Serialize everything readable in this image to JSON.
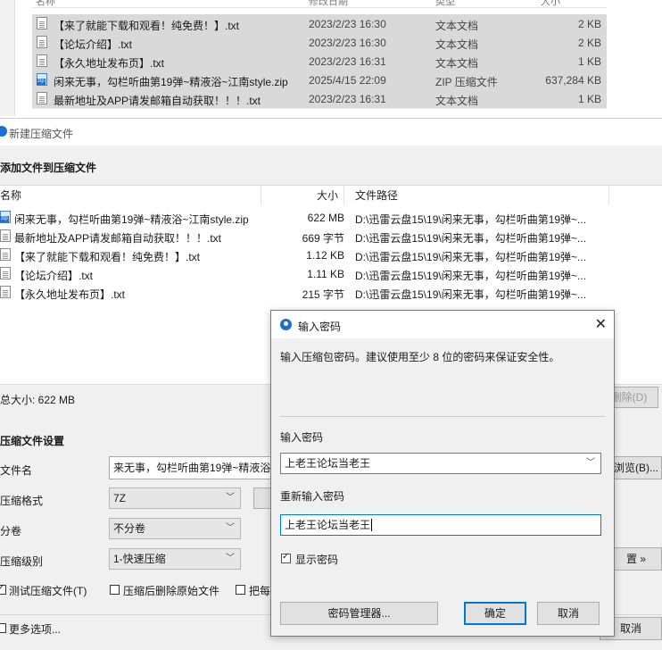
{
  "explorer": {
    "columns": [
      "名称",
      "修改日期",
      "类型",
      "大小"
    ],
    "rows": [
      {
        "name": "【来了就能下载和观看！纯免费！】.txt",
        "date": "2023/2/23 16:30",
        "type": "文本文档",
        "size": "2 KB",
        "icon": "txt-file-icon"
      },
      {
        "name": "【论坛介绍】.txt",
        "date": "2023/2/23 16:30",
        "type": "文本文档",
        "size": "2 KB",
        "icon": "txt-file-icon"
      },
      {
        "name": "【永久地址发布页】.txt",
        "date": "2023/2/23 16:31",
        "type": "文本文档",
        "size": "1 KB",
        "icon": "txt-file-icon"
      },
      {
        "name": "闲来无事，勾栏听曲第19弹~精液浴~江南style.zip",
        "date": "2025/4/15 22:09",
        "type": "ZIP 压缩文件",
        "size": "637,284 KB",
        "icon": "zip-file-icon"
      },
      {
        "name": "最新地址及APP请发邮箱自动获取！！！.txt",
        "date": "2023/2/23 16:31",
        "type": "文本文档",
        "size": "1 KB",
        "icon": "txt-file-icon"
      }
    ]
  },
  "compress_window": {
    "title": "新建压缩文件",
    "section_add": "添加文件到压缩文件",
    "list_headers": {
      "name": "名称",
      "size": "大小",
      "path": "文件路径"
    },
    "files": [
      {
        "name": "闲来无事，勾栏听曲第19弹~精液浴~江南style.zip",
        "size": "622 MB",
        "path": "D:\\迅雷云盘15\\19\\闲来无事，勾栏听曲第19弹~...",
        "icon": "zip-file-icon"
      },
      {
        "name": "最新地址及APP请发邮箱自动获取！！！.txt",
        "size": "669 字节",
        "path": "D:\\迅雷云盘15\\19\\闲来无事，勾栏听曲第19弹~...",
        "icon": "txt-file-icon"
      },
      {
        "name": "【来了就能下载和观看！纯免费！】.txt",
        "size": "1.12 KB",
        "path": "D:\\迅雷云盘15\\19\\闲来无事，勾栏听曲第19弹~...",
        "icon": "txt-file-icon"
      },
      {
        "name": "【论坛介绍】.txt",
        "size": "1.11 KB",
        "path": "D:\\迅雷云盘15\\19\\闲来无事，勾栏听曲第19弹~...",
        "icon": "txt-file-icon"
      },
      {
        "name": "【永久地址发布页】.txt",
        "size": "215 字节",
        "path": "D:\\迅雷云盘15\\19\\闲来无事，勾栏听曲第19弹~...",
        "icon": "txt-file-icon"
      }
    ],
    "total_size": "总大小: 622 MB",
    "delete_label": "删除(D)",
    "settings_title": "压缩文件设置",
    "filename_label": "文件名",
    "filename_value": "来无事，勾栏听曲第19弹~精液浴",
    "browse_label": "浏览(B)...",
    "format_label": "压缩格式",
    "format_value": "7Z",
    "split_label": "分卷",
    "split_value": "不分卷",
    "level_label": "压缩级别",
    "level_value": "1-快速压缩",
    "more_btn_label": "置 »",
    "test_label": "测试压缩文件(T)",
    "delete_after_label": "压缩后删除原始文件",
    "each_label": "把每",
    "more_options_label": "更多选项...",
    "cancel_label": "取消"
  },
  "password_dialog": {
    "title": "输入密码",
    "description": "输入压缩包密码。建议使用至少 8 位的密码来保证安全性。",
    "password_label": "输入密码",
    "password_value": "上老王论坛当老王",
    "confirm_label": "重新输入密码",
    "confirm_value": "上老王论坛当老王",
    "show_password_label": "显示密码",
    "manager_btn": "密码管理器...",
    "ok_btn": "确定",
    "cancel_btn": "取消",
    "accent_color": "#0078d7"
  }
}
